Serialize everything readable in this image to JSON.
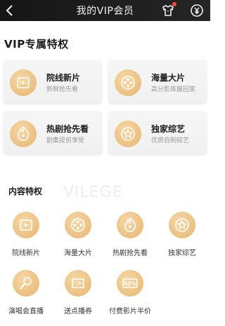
{
  "header": {
    "title": "我的VIP会员",
    "back_icon": "chevron-left-icon",
    "gift_icon": "shirt-gift-icon",
    "coin_icon": "currency-icon",
    "badge_color": "#ff4a3d"
  },
  "vip_section": {
    "title": "VIP专属特权",
    "cards": [
      {
        "title": "院线新片",
        "subtitle": "新鲜抢先看",
        "icon": "movie-ticket-icon"
      },
      {
        "title": "海量大片",
        "subtitle": "高分影库搬回家",
        "icon": "film-reel-icon"
      },
      {
        "title": "热剧抢先看",
        "subtitle": "剧集提前享受",
        "icon": "flame-play-icon"
      },
      {
        "title": "独家综艺",
        "subtitle": "优质自制综艺",
        "icon": "star-badge-icon"
      }
    ]
  },
  "content_section": {
    "title": "内容特权",
    "watermark": "VILEGE",
    "items": [
      {
        "label": "院线新片",
        "icon": "movie-ticket-icon"
      },
      {
        "label": "海量大片",
        "icon": "film-reel-icon"
      },
      {
        "label": "热剧抢先看",
        "icon": "flame-play-icon"
      },
      {
        "label": "独家综艺",
        "icon": "star-badge-icon"
      },
      {
        "label": "演唱会直播",
        "icon": "microphone-icon"
      },
      {
        "label": "送点播券",
        "icon": "ticket-icon"
      },
      {
        "label": "付费影片半价",
        "icon": "fifty-percent-icon",
        "badge_text": "50%"
      }
    ]
  },
  "colors": {
    "accent_gold": "#e7b56f",
    "header_bg": "#1b1b1b"
  }
}
